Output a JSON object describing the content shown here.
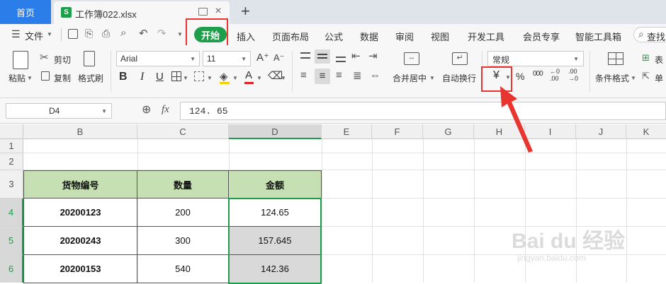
{
  "tabs": {
    "home": "首页",
    "file_name": "工作簿022.xlsx",
    "file_icon_letter": "S",
    "new_tab": "+"
  },
  "menu": {
    "file_label": "文件",
    "items": [
      "开始",
      "插入",
      "页面布局",
      "公式",
      "数据",
      "审阅",
      "视图",
      "开发工具",
      "会员专享",
      "智能工具箱"
    ],
    "search_label": "查找"
  },
  "ribbon": {
    "paste_label": "粘贴",
    "cut_label": "剪切",
    "copy_label": "复制",
    "format_painter_label": "格式刷",
    "font_name": "Arial",
    "font_size": "11",
    "grow_font": "A⁺",
    "shrink_font": "A⁻",
    "bold": "B",
    "italic": "I",
    "underline": "U",
    "font_color": "A",
    "merge_label": "合并居中",
    "wrap_label": "自动换行",
    "number_format": "常规",
    "currency_symbol": "¥",
    "percent_symbol": "%",
    "thousands_symbol": "000",
    "inc_decimal": "←0 .00",
    "dec_decimal": ".00 →0",
    "cond_format_label": "条件格式",
    "table_style_label": "表",
    "single_label": "单"
  },
  "formula_bar": {
    "name_box": "D4",
    "fx_label": "fx",
    "value": "124. 65"
  },
  "columns": [
    "B",
    "C",
    "D",
    "E",
    "F",
    "G",
    "H",
    "I",
    "J",
    "K"
  ],
  "rows": [
    "1",
    "2",
    "3",
    "4",
    "5",
    "6"
  ],
  "table": {
    "headers": [
      "货物编号",
      "数量",
      "金额"
    ],
    "rows": [
      [
        "20200123",
        "200",
        "124.65"
      ],
      [
        "20200243",
        "300",
        "157.645"
      ],
      [
        "20200153",
        "540",
        "142.36"
      ]
    ]
  },
  "watermark": {
    "brand": "Bai du 经验",
    "url": "jingyan.baidu.com"
  },
  "colors": {
    "accent_green": "#1e9e4a",
    "header_fill": "#c6e0b4",
    "selection": "#d9d9d9",
    "annotation_red": "#e8352f",
    "tab_blue": "#2b7de9"
  }
}
